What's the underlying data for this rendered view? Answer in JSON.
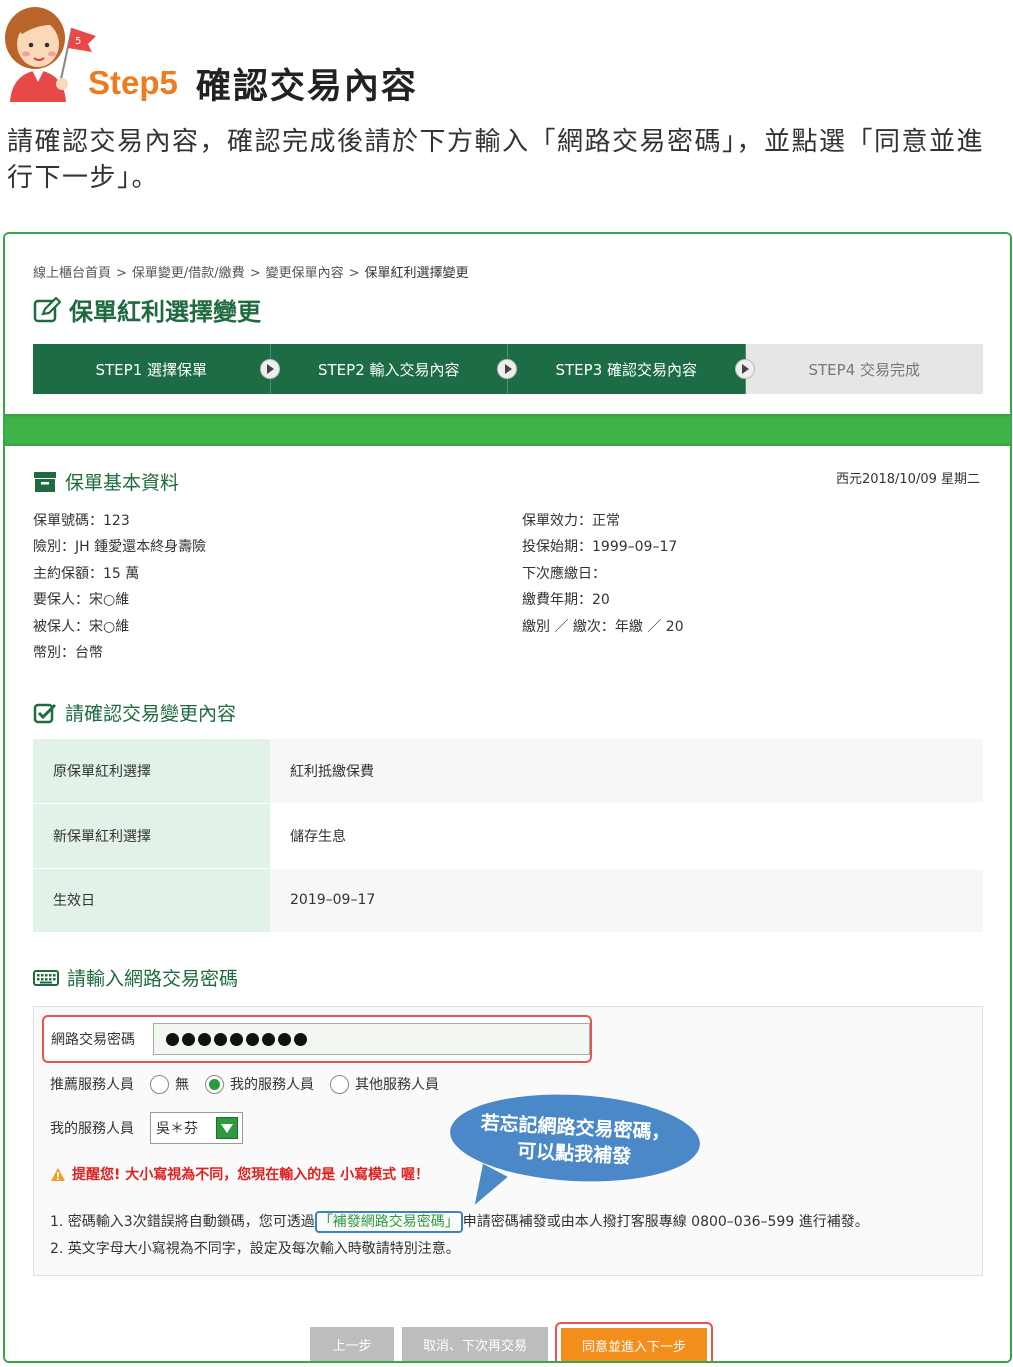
{
  "tutorial": {
    "step_label": "Step5",
    "step_title": "確認交易內容",
    "flag_number": "5",
    "instruction": "請確認交易內容，確認完成後請於下方輸入「網路交易密碼」，並點選「同意並進行下一步」。"
  },
  "breadcrumb": [
    "線上櫃台首頁",
    "保單變更/借款/繳費",
    "變更保單內容",
    "保單紅利選擇變更"
  ],
  "breadcrumb_sep": ">",
  "page_title": "保單紅利選擇變更",
  "steps": [
    {
      "label": "STEP1 選擇保單",
      "active": true
    },
    {
      "label": "STEP2 輸入交易內容",
      "active": true
    },
    {
      "label": "STEP3 確認交易內容",
      "active": true
    },
    {
      "label": "STEP4 交易完成",
      "active": false
    }
  ],
  "policy_info": {
    "title": "保單基本資料",
    "date": "西元2018/10/09 星期二",
    "left": [
      "保單號碼：123",
      "險別：JH 鍾愛還本終身壽險",
      "主約保額：15 萬",
      "要保人：宋○維",
      "被保人：宋○維",
      "幣別：台幣"
    ],
    "right": [
      "保單效力：正常",
      "投保始期：1999–09–17",
      "下次應繳日：",
      "繳費年期：20",
      "繳別 ／ 繳次：年繳 ／ 20"
    ]
  },
  "confirm": {
    "title": "請確認交易變更內容",
    "rows": [
      {
        "key": "原保單紅利選擇",
        "value": "紅利抵繳保費"
      },
      {
        "key": "新保單紅利選擇",
        "value": "儲存生息"
      },
      {
        "key": "生效日",
        "value": "2019–09–17"
      }
    ]
  },
  "password": {
    "title": "請輸入網路交易密碼",
    "field_label": "網路交易密碼",
    "masked_length": 9,
    "referral_label": "推薦服務人員",
    "referral_options": [
      {
        "label": "無",
        "checked": false
      },
      {
        "label": "我的服務人員",
        "checked": true
      },
      {
        "label": "其他服務人員",
        "checked": false
      }
    ],
    "agent_label": "我的服務人員",
    "agent_value": "吳＊芬",
    "warning": "提醒您! 大小寫視為不同，您現在輸入的是 小寫模式 喔！",
    "note1_prefix": "1. 密碼輸入3次錯誤將自動鎖碼，您可透過",
    "note1_link": "「補發網路交易密碼」",
    "note1_suffix": "申請密碼補發或由本人撥打客服專線 0800–036–599 進行補發。",
    "note2": "2. 英文字母大小寫視為不同字，設定及每次輸入時敬請特別注意。"
  },
  "bubble": {
    "line1": "若忘記網路交易密碼，",
    "line2": "可以點我補發"
  },
  "buttons": {
    "prev": "上一步",
    "cancel": "取消、下次再交易",
    "next": "同意並進入下一步"
  },
  "colors": {
    "brand_green": "#1c6d45",
    "band_green": "#3db34a",
    "accent_orange": "#f28e1c",
    "highlight_red": "#e25555",
    "bubble_blue": "#4a88c8"
  }
}
